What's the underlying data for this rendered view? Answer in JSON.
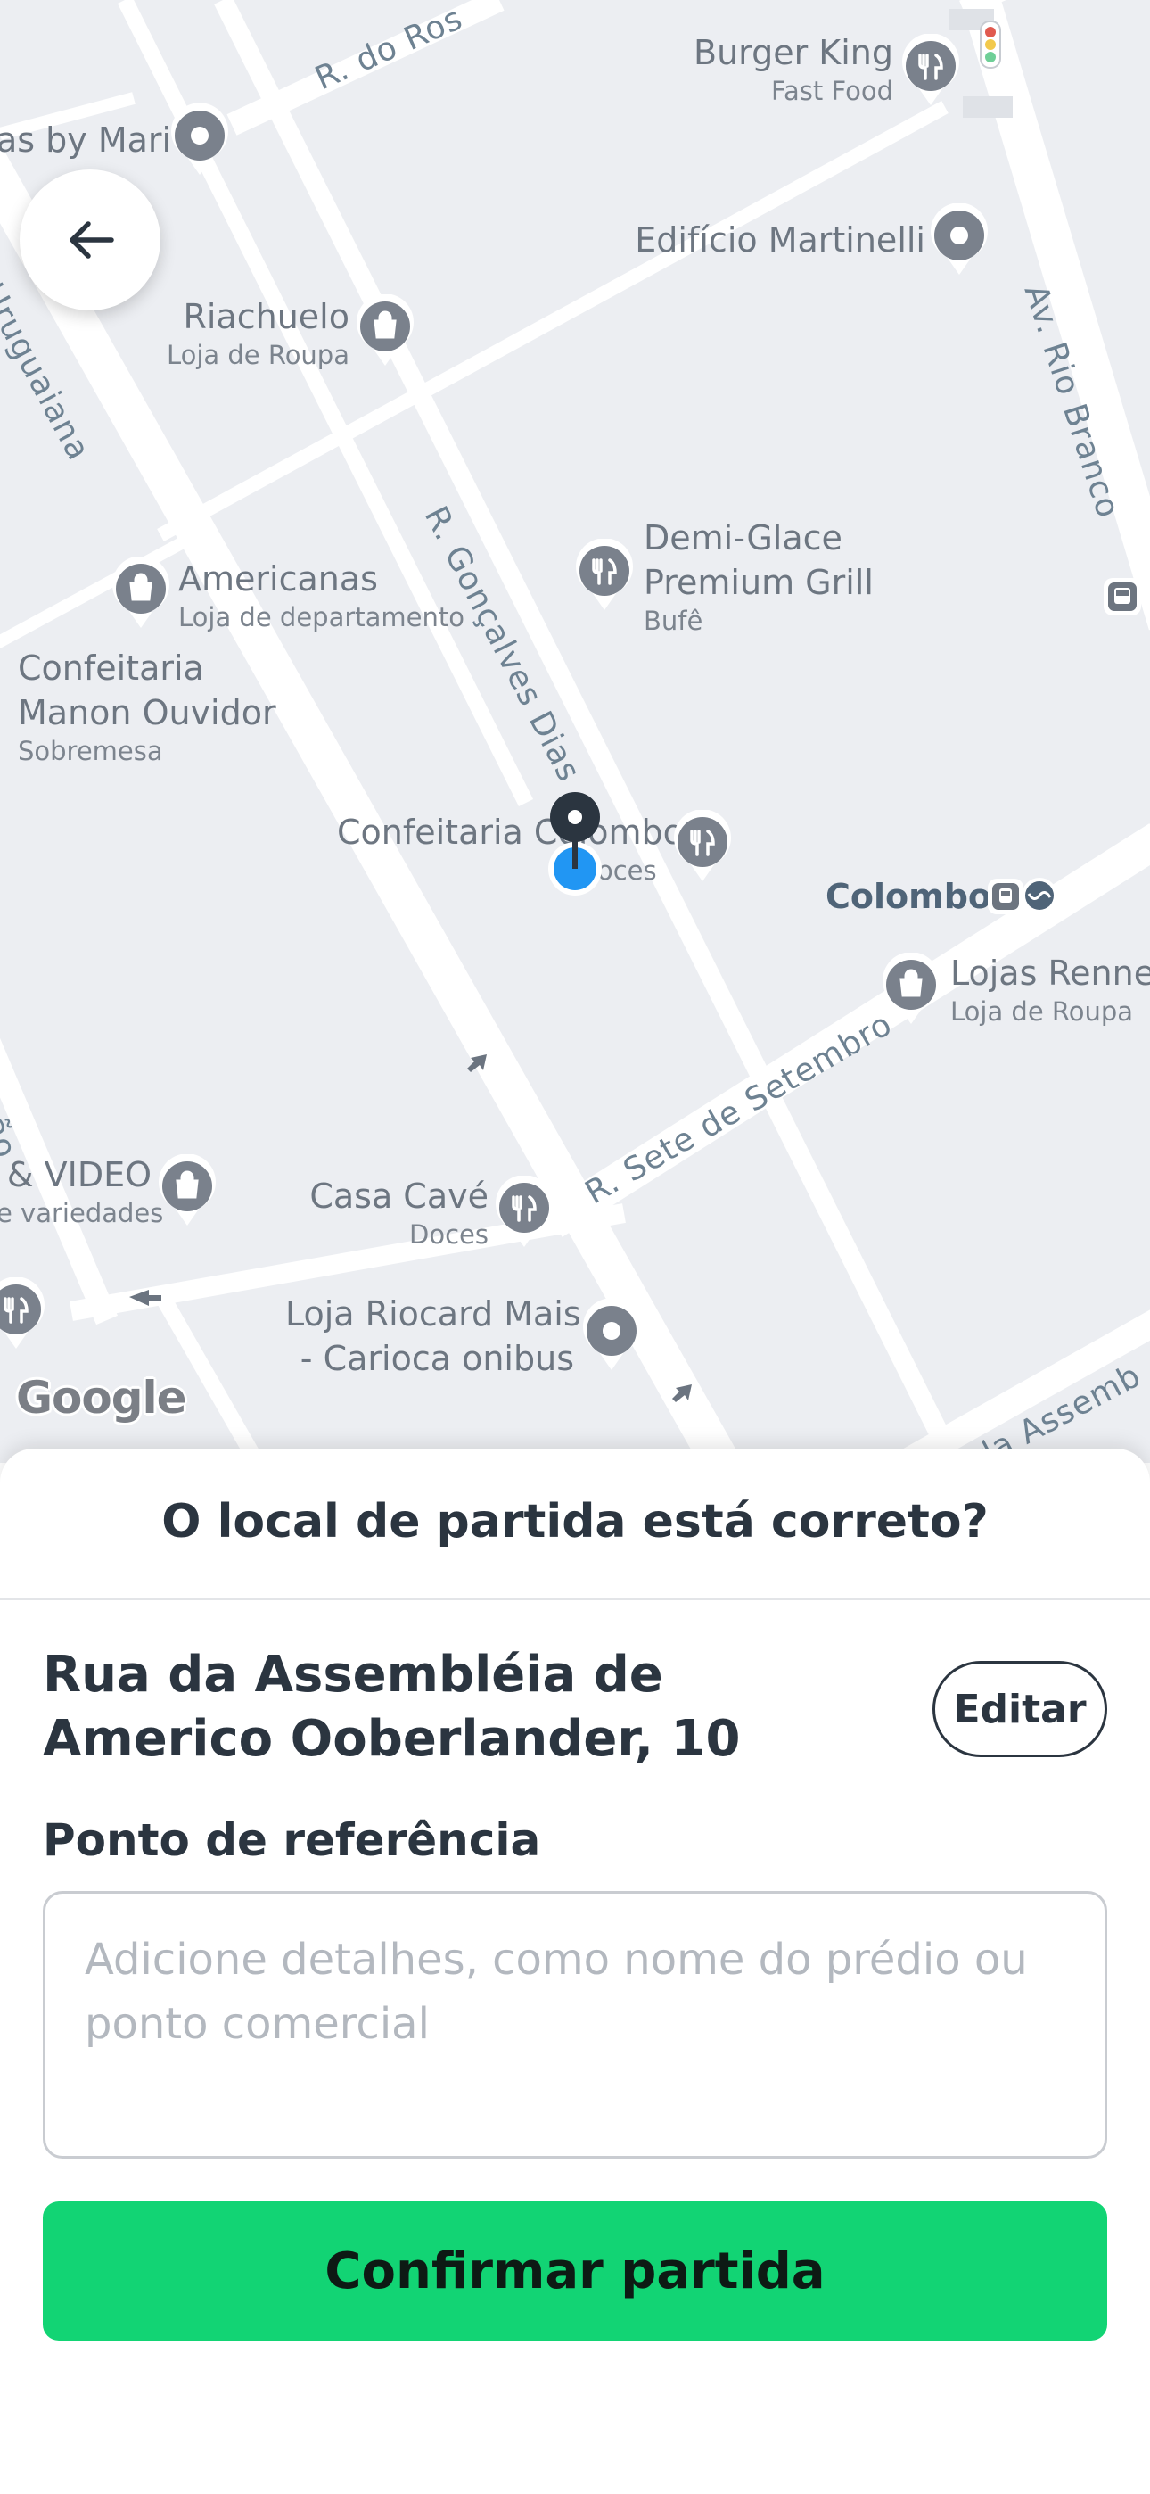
{
  "map": {
    "streets": {
      "r_do_rosario": "R. do Ros",
      "uruguaiana": "Uruguaiana",
      "goncalves_dias": "R. Gonçalves Dias",
      "rio_branco": "Av. Rio Branco",
      "sete_de_setembro": "R. Sete de Setembro",
      "assembleia": "R. da Assemb",
      "left_vertical": "igão"
    },
    "pois": {
      "burger_king": {
        "name": "Burger King",
        "category": "Fast Food"
      },
      "mari": {
        "name": "as by Mari"
      },
      "martinelli": {
        "name": "Edifício Martinelli"
      },
      "riachuelo": {
        "name": "Riachuelo",
        "category": "Loja de Roupa"
      },
      "demi_glace": {
        "name_line1": "Demi-Glace",
        "name_line2": "Premium Grill",
        "category": "Bufê"
      },
      "americanas": {
        "name": "Americanas",
        "category": "Loja de departamento"
      },
      "manon": {
        "name_line1": "Confeitaria",
        "name_line2": "Manon Ouvidor",
        "category": "Sobremesa"
      },
      "colombo_conf": {
        "name": "Confeitaria Colombo",
        "category": "oces"
      },
      "colombo_station": {
        "name": "Colombo"
      },
      "renner": {
        "name": "Lojas Renner",
        "category": "Loja de Roupa"
      },
      "video": {
        "name": "& VIDEO",
        "category": "e variedades"
      },
      "casa_cave": {
        "name": "Casa Cavé",
        "category": "Doces"
      },
      "riocard": {
        "name_line1": "Loja Riocard Mais",
        "name_line2": "- Carioca onibus"
      }
    },
    "google_logo": "Google",
    "colors": {
      "background": "#eceef2",
      "road": "#ffffff",
      "pin_gray": "#7a818c",
      "user_dot": "#2196f3",
      "marker": "#2b3540"
    }
  },
  "sheet": {
    "title": "O local de partida está correto?",
    "address": "Rua da Assembléia de Americo Ooberlander, 10",
    "edit_label": "Editar",
    "reference_label": "Ponto de referência",
    "reference_placeholder": "Adicione detalhes, como nome do prédio ou ponto comercial",
    "reference_value": "",
    "confirm_label": "Confirmar partida",
    "colors": {
      "confirm_bg": "#12d474",
      "text": "#2b3540"
    }
  }
}
